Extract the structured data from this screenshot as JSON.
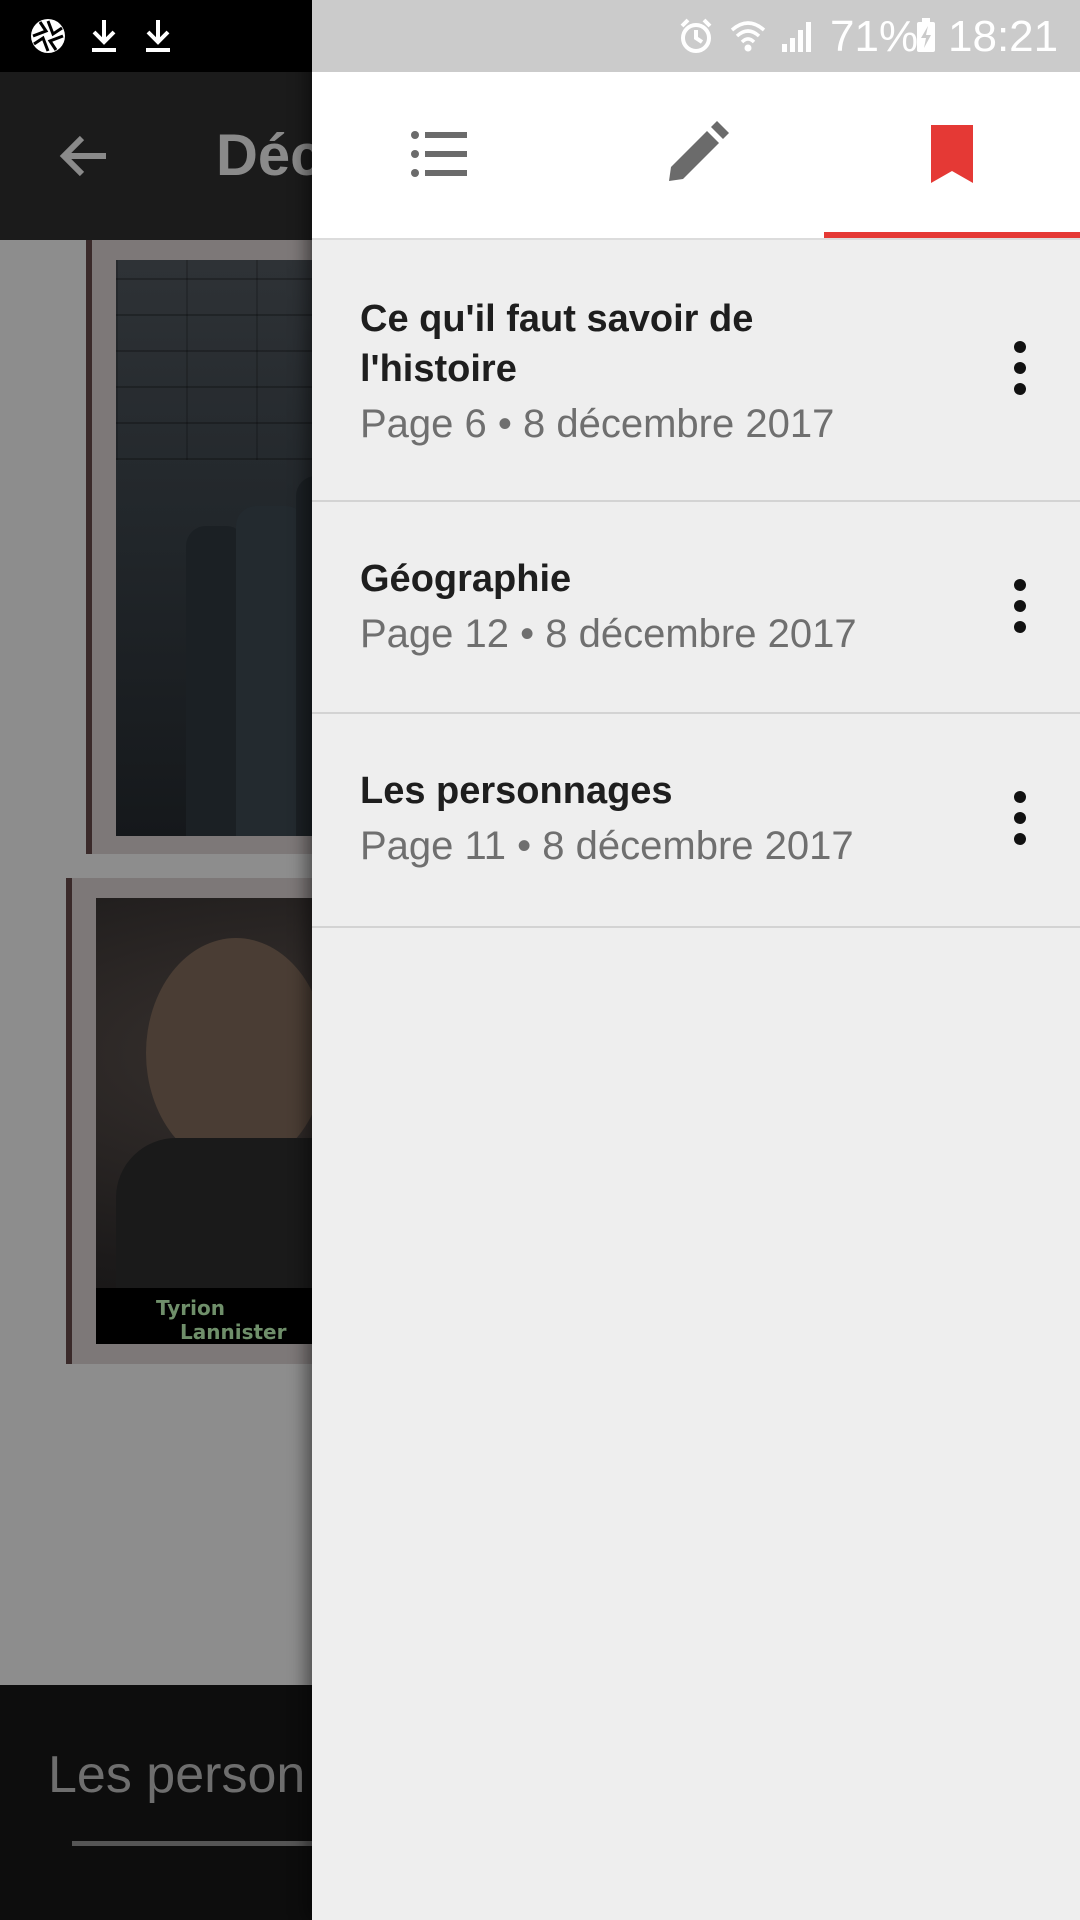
{
  "background": {
    "toolbar_title": "Déc",
    "image_caption_line1": "Tyrion",
    "image_caption_line2": "Lannister",
    "bottom_text": "Les person"
  },
  "status_bar": {
    "battery_percent": "71%",
    "time": "18:21",
    "icons": [
      "aperture-icon",
      "download-icon",
      "download-icon",
      "alarm-icon",
      "wifi-icon",
      "signal-icon",
      "battery-charging-icon"
    ]
  },
  "tabs": [
    {
      "icon": "list-icon",
      "selected": false
    },
    {
      "icon": "pencil-icon",
      "selected": false
    },
    {
      "icon": "bookmark-icon",
      "selected": true
    }
  ],
  "bookmarks": [
    {
      "title": "Ce qu'il faut savoir de l'histoire",
      "meta": "Page 6 • 8 décembre 2017"
    },
    {
      "title": "Géographie",
      "meta": "Page 12 • 8 décembre 2017"
    },
    {
      "title": "Les personnages",
      "meta": "Page 11 • 8 décembre 2017"
    }
  ],
  "colors": {
    "accent": "#e53935",
    "drawer_background": "#eeeeee",
    "tab_icon": "#6b6b6b",
    "title_text": "#1e1e1e",
    "meta_text": "#6f6f6f"
  }
}
